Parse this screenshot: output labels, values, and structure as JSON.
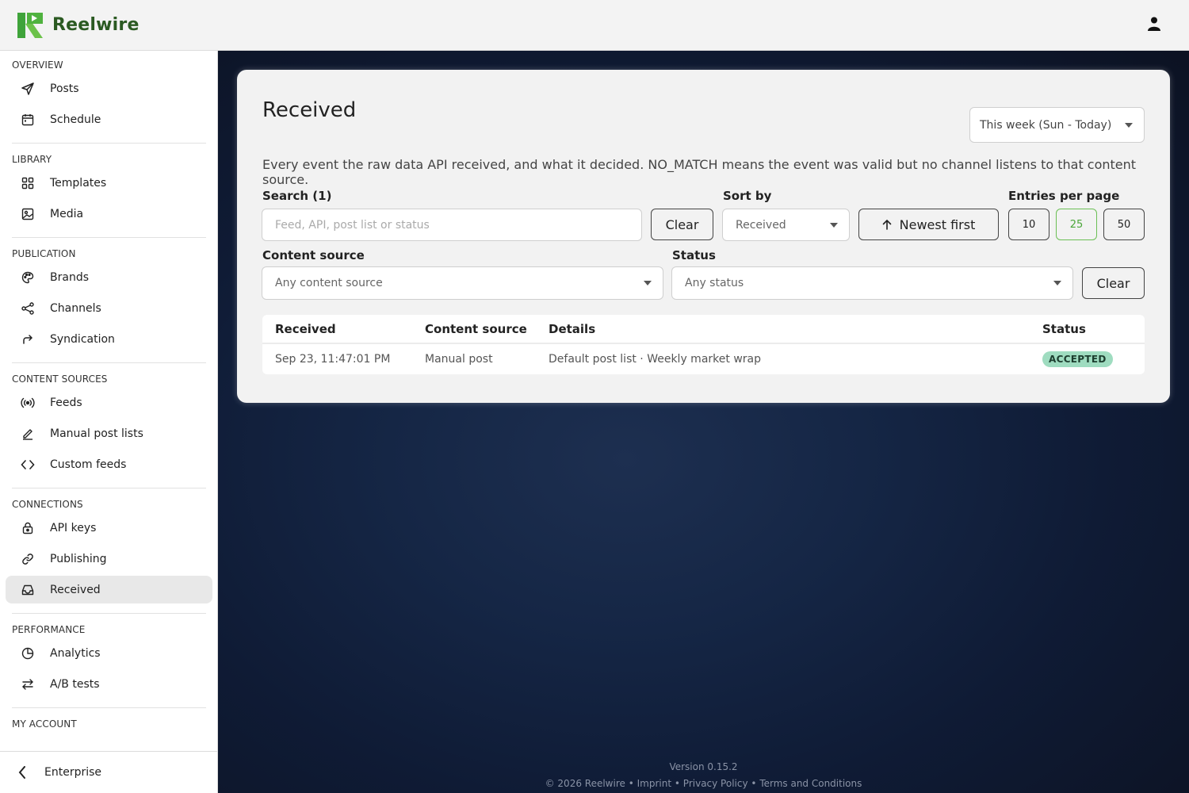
{
  "app": {
    "name": "Reelwire"
  },
  "sidebar": {
    "sections": [
      {
        "title": "OVERVIEW",
        "items": [
          {
            "label": "Posts",
            "icon": "send-icon"
          },
          {
            "label": "Schedule",
            "icon": "calendar-icon"
          }
        ]
      },
      {
        "title": "LIBRARY",
        "items": [
          {
            "label": "Templates",
            "icon": "grid-icon"
          },
          {
            "label": "Media",
            "icon": "image-icon"
          }
        ]
      },
      {
        "title": "PUBLICATION",
        "items": [
          {
            "label": "Brands",
            "icon": "palette-icon"
          },
          {
            "label": "Channels",
            "icon": "share-icon"
          },
          {
            "label": "Syndication",
            "icon": "forward-arrow-icon"
          }
        ]
      },
      {
        "title": "CONTENT SOURCES",
        "items": [
          {
            "label": "Feeds",
            "icon": "broadcast-icon"
          },
          {
            "label": "Manual post lists",
            "icon": "pencil-icon"
          },
          {
            "label": "Custom feeds",
            "icon": "code-icon"
          }
        ]
      },
      {
        "title": "CONNECTIONS",
        "items": [
          {
            "label": "API keys",
            "icon": "lock-icon"
          },
          {
            "label": "Publishing",
            "icon": "link-icon"
          },
          {
            "label": "Received",
            "icon": "inbox-icon",
            "active": true
          }
        ]
      },
      {
        "title": "PERFORMANCE",
        "items": [
          {
            "label": "Analytics",
            "icon": "pie-chart-icon"
          },
          {
            "label": "A/B tests",
            "icon": "swap-arrows-icon"
          }
        ]
      },
      {
        "title": "MY ACCOUNT",
        "items": []
      }
    ],
    "footer_label": "Enterprise"
  },
  "page": {
    "title": "Received",
    "range_value": "This week (Sun - Today)",
    "description": "Every event the raw data API received, and what it decided. NO_MATCH means the event was valid but no channel listens to that content source."
  },
  "filters": {
    "search_label": "Search (1)",
    "search_placeholder": "Feed, API, post list or status",
    "search_clear": "Clear",
    "sort_label": "Sort by",
    "sort_value": "Received",
    "order_label": "Newest first",
    "entries_label": "Entries per page",
    "entries_options": [
      "10",
      "25",
      "50"
    ],
    "entries_selected": "25",
    "content_source_label": "Content source",
    "content_source_value": "Any content source",
    "status_label": "Status",
    "status_value": "Any status",
    "filters_clear": "Clear"
  },
  "table": {
    "columns": [
      "Received",
      "Content source",
      "Details",
      "Status"
    ],
    "rows": [
      {
        "received": "Sep 23, 11:47:01 PM",
        "source": "Manual post",
        "details": "Default post list · Weekly market wrap",
        "status": "ACCEPTED"
      }
    ]
  },
  "footer": {
    "version": "Version 0.15.2",
    "copyright": "© 2026 Reelwire",
    "links": [
      "Imprint",
      "Privacy Policy",
      "Terms and Conditions"
    ],
    "separator": "•"
  },
  "colors": {
    "brand_green": "#2b5a22",
    "accent_green": "#4ba63a",
    "badge_bg": "#9fdcc0",
    "main_bg": "#0f1b35"
  }
}
